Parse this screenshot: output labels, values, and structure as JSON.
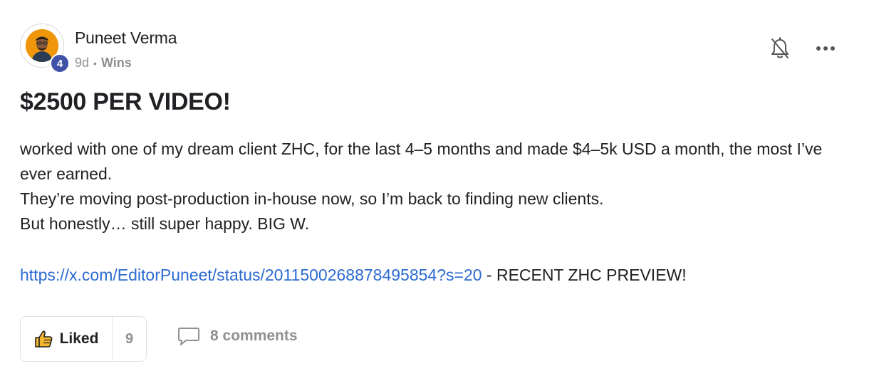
{
  "author": {
    "name": "Puneet Verma",
    "level": "4",
    "time_ago": "9d",
    "separator": "•",
    "category": "Wins"
  },
  "header_actions": {
    "notification_icon": "bell-off-icon",
    "more_icon": "more-horizontal-icon"
  },
  "post": {
    "title": "$2500 PER VIDEO!",
    "paragraphs": [
      "worked with one of my dream client ZHC, for the last 4–5 months and made $4–5k USD a month, the most I’ve ever earned.",
      "They’re moving post-production in-house now, so I’m back to finding new clients.",
      "But honestly… still super happy. BIG W."
    ],
    "link_url": "https://x.com/EditorPuneet/status/2011500268878495854?s=20",
    "link_suffix": " - RECENT ZHC PREVIEW!"
  },
  "footer": {
    "like_label": "Liked",
    "like_count": "9",
    "like_icon": "thumbs-up-icon",
    "comments_label": "8 comments",
    "comments_icon": "comment-icon"
  },
  "colors": {
    "accent_link": "#2d6ad1",
    "level_badge": "#3f52a8",
    "muted_text": "#909090",
    "like_icon_fill": "#f5b82e"
  }
}
